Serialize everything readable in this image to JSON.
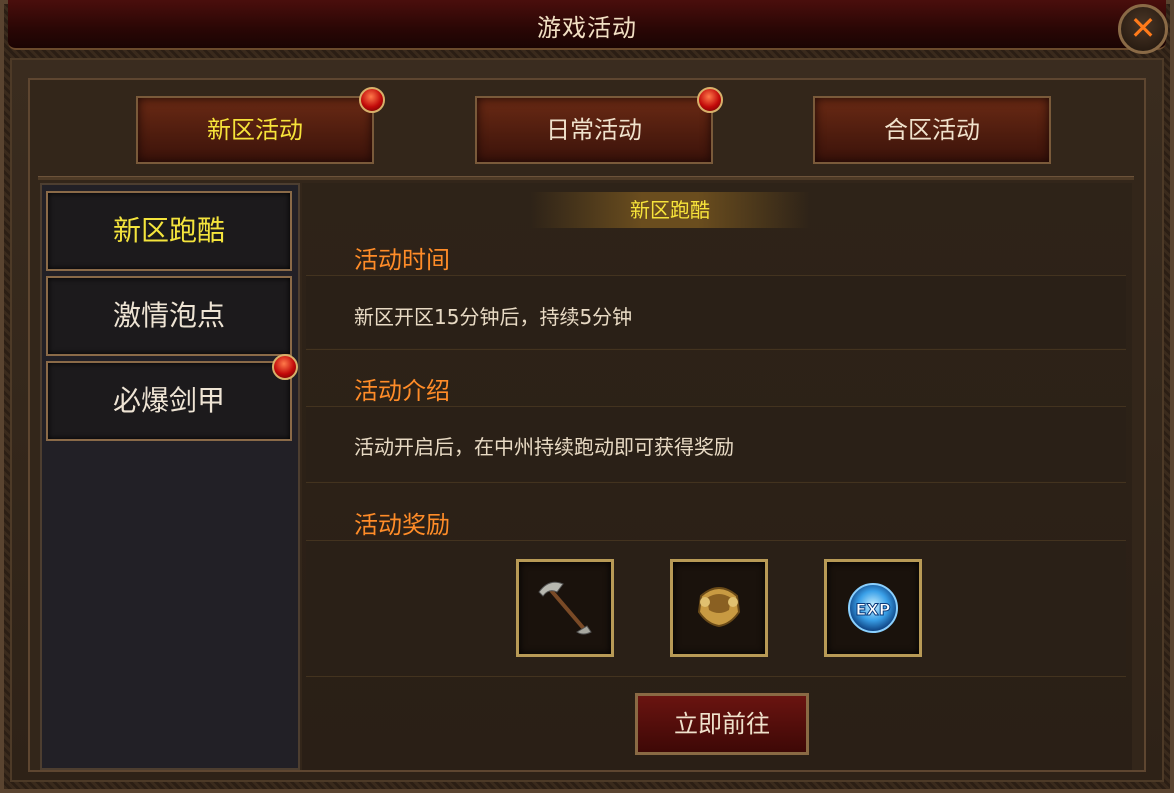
{
  "window": {
    "title": "游戏活动"
  },
  "tabs": [
    {
      "label": "新区活动",
      "active": true,
      "has_alert": true
    },
    {
      "label": "日常活动",
      "active": false,
      "has_alert": true
    },
    {
      "label": "合区活动",
      "active": false,
      "has_alert": false
    }
  ],
  "sidebar": {
    "items": [
      {
        "label": "新区跑酷",
        "active": true,
        "has_alert": false
      },
      {
        "label": "激情泡点",
        "active": false,
        "has_alert": false
      },
      {
        "label": "必爆剑甲",
        "active": false,
        "has_alert": true
      }
    ]
  },
  "detail": {
    "banner": "新区跑酷",
    "time_heading": "活动时间",
    "time_text": "新区开区15分钟后，持续5分钟",
    "intro_heading": "活动介绍",
    "intro_text": "活动开启后，在中州持续跑动即可获得奖励",
    "reward_heading": "活动奖励",
    "rewards": [
      {
        "icon": "pickaxe-icon"
      },
      {
        "icon": "gold-armor-icon"
      },
      {
        "icon": "exp-orb-icon",
        "label": "EXP"
      }
    ],
    "go_button": "立即前往"
  },
  "colors": {
    "heading": "#ff8c28",
    "active_text": "#f7e33a",
    "alert_dot": "#c20a0a"
  }
}
